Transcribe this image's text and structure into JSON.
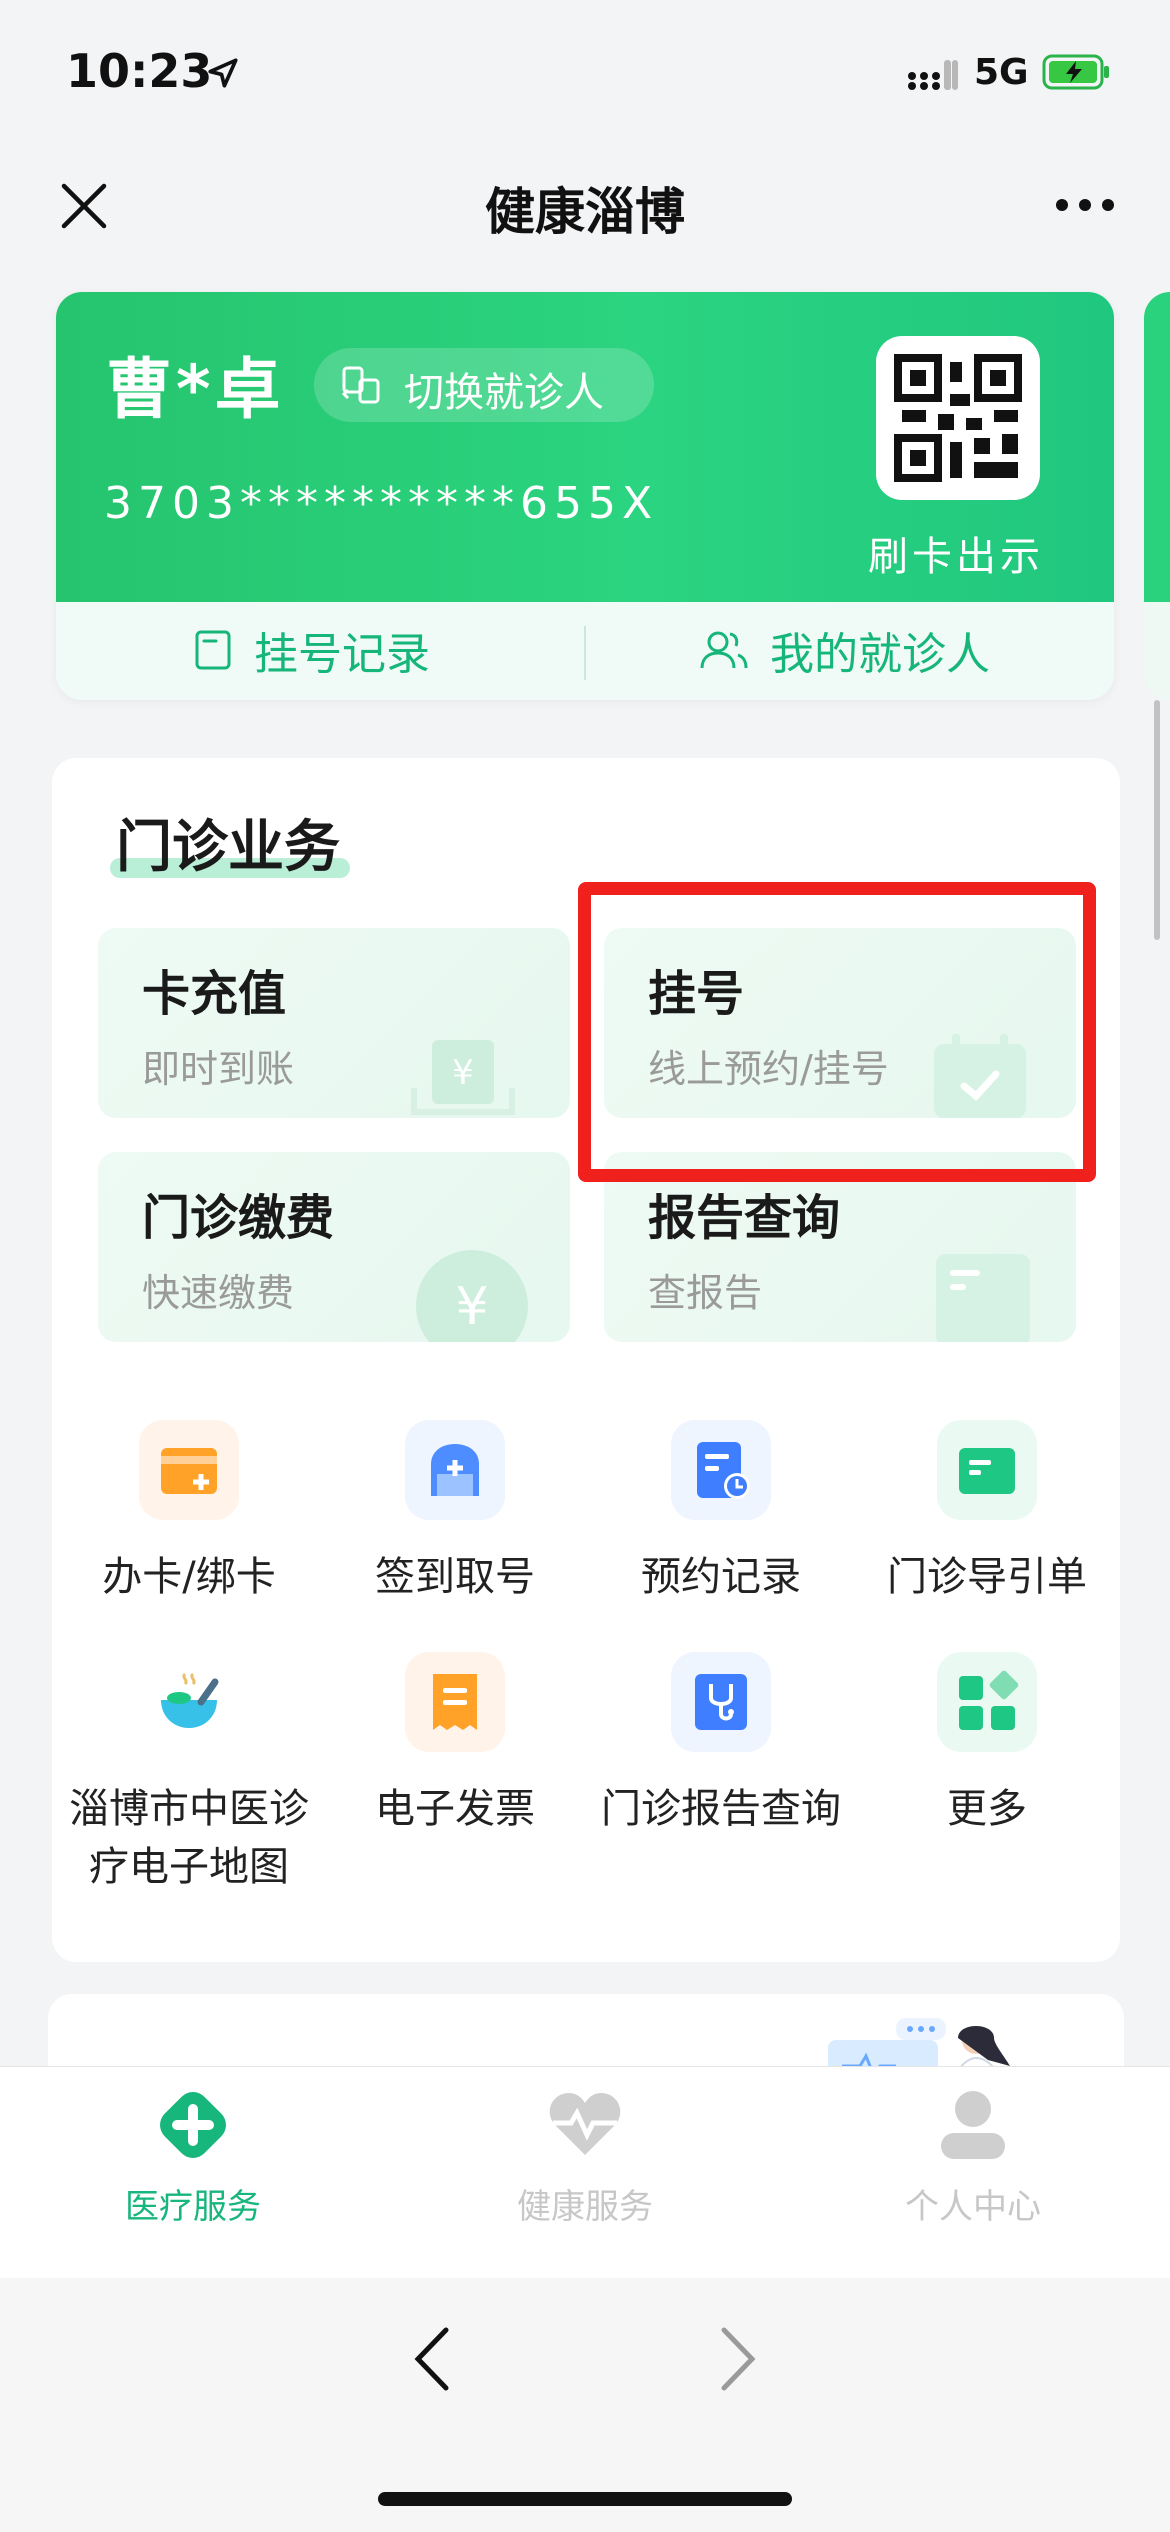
{
  "status_bar": {
    "time": "10:23",
    "network": "5G"
  },
  "nav": {
    "title": "健康淄博"
  },
  "card": {
    "patient_name": "曹*卓",
    "switch_label": "切换就诊人",
    "id_number": "3703**********655X",
    "qr_label": "刷卡出示",
    "link_records": "挂号记录",
    "link_patients": "我的就诊人"
  },
  "outpatient": {
    "title": "门诊业务",
    "tiles": [
      {
        "title": "卡充值",
        "sub": "即时到账"
      },
      {
        "title": "挂号",
        "sub": "线上预约/挂号"
      },
      {
        "title": "门诊缴费",
        "sub": "快速缴费"
      },
      {
        "title": "报告查询",
        "sub": "查报告"
      }
    ],
    "grid": [
      {
        "label": "办卡/绑卡"
      },
      {
        "label": "签到取号"
      },
      {
        "label": "预约记录"
      },
      {
        "label": "门诊导引单"
      },
      {
        "label": "淄博市中医诊疗电子地图"
      },
      {
        "label": "电子发票"
      },
      {
        "label": "门诊报告查询"
      },
      {
        "label": "更多"
      }
    ]
  },
  "tabbar": {
    "tabs": [
      {
        "label": "医疗服务",
        "active": true
      },
      {
        "label": "健康服务",
        "active": false
      },
      {
        "label": "个人中心",
        "active": false
      }
    ]
  },
  "colors": {
    "brand": "#1fc47a",
    "highlight": "#f0201c"
  }
}
